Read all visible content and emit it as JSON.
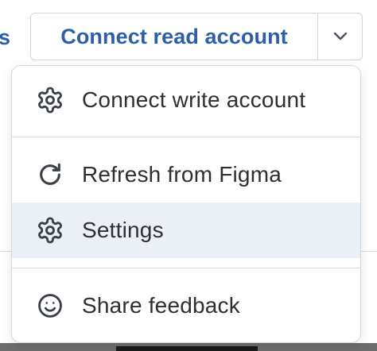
{
  "header": {
    "left_link_text": "s",
    "primary_button_label": "Connect read account"
  },
  "menu": {
    "items": [
      {
        "label": "Connect write account",
        "icon": "gear-icon"
      },
      {
        "label": "Refresh from Figma",
        "icon": "refresh-icon"
      },
      {
        "label": "Settings",
        "icon": "gear-icon",
        "highlighted": true
      },
      {
        "label": "Share feedback",
        "icon": "smile-icon"
      }
    ]
  },
  "colors": {
    "accent": "#2d5fa9",
    "highlight": "#ebf0f6",
    "text": "#2c2f33",
    "border": "#cfd5dc"
  }
}
